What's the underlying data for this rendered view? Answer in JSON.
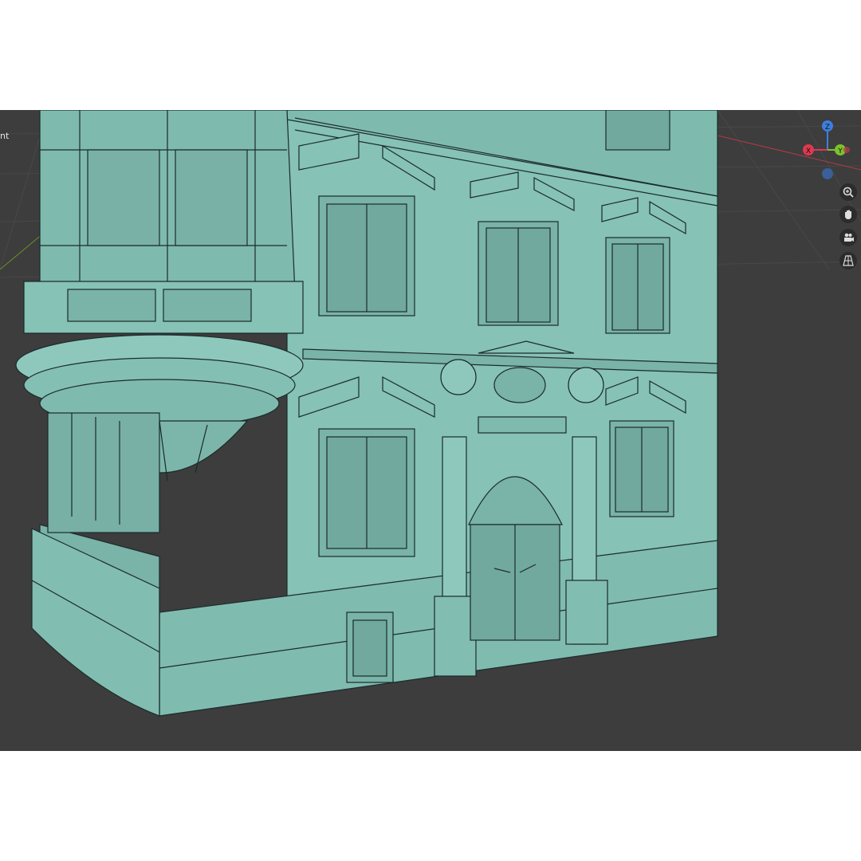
{
  "viewport": {
    "header_text_fragment": "nt",
    "background_color": "#3d3d3d",
    "mesh_color": "#86c2b6",
    "wire_color": "#1b2b2b"
  },
  "gizmo": {
    "axes": [
      {
        "label": "Z",
        "color": "#3c7fe0"
      },
      {
        "label": "X",
        "color": "#e0384f"
      },
      {
        "label": "Y",
        "color": "#7cc22c"
      }
    ]
  },
  "nav_tools": [
    {
      "name": "zoom",
      "icon": "zoom-icon"
    },
    {
      "name": "pan",
      "icon": "hand-icon"
    },
    {
      "name": "camera",
      "icon": "camera-icon"
    },
    {
      "name": "perspective",
      "icon": "grid-icon"
    }
  ]
}
